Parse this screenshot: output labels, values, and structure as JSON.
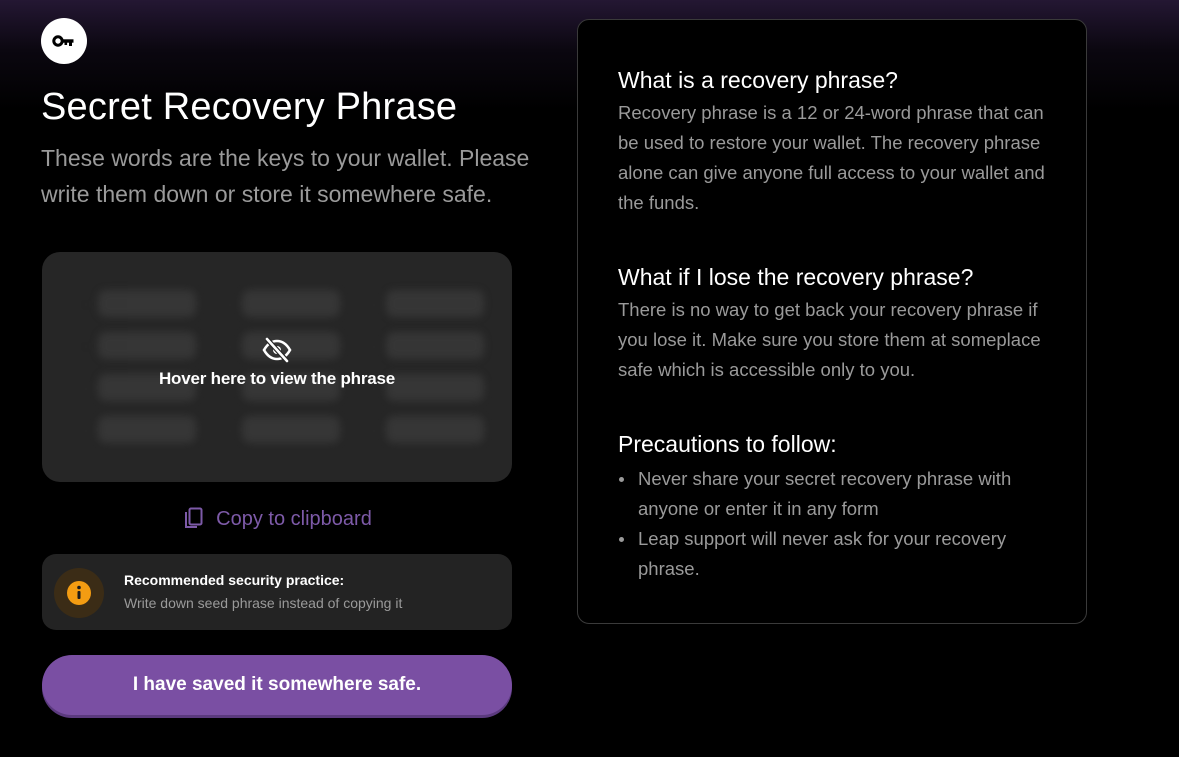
{
  "header": {
    "icon": "key-icon",
    "title": "Secret Recovery Phrase",
    "subtitle": "These words are the keys to your wallet. Please write them down or store it somewhere safe."
  },
  "phrase_box": {
    "hover_label": "Hover here to view the phrase",
    "hidden_icon": "eye-off-icon"
  },
  "copy": {
    "icon": "copy-icon",
    "label": "Copy to clipboard",
    "color": "#7d5aa8"
  },
  "alert": {
    "icon": "info-icon",
    "title": "Recommended security practice:",
    "description": "Write down seed phrase instead of copying it",
    "accent": "#f39c12"
  },
  "primary_button": {
    "label": "I have saved it somewhere safe.",
    "color": "#7a4fa3"
  },
  "info": {
    "sections": [
      {
        "heading": "What is a recovery phrase?",
        "body": "Recovery phrase is a 12 or 24-word phrase that can be used to restore your wallet. The recovery phrase alone can give anyone full access to your wallet and the funds."
      },
      {
        "heading": "What if I lose the recovery phrase?",
        "body": "There is no way to get back your recovery phrase if you lose it. Make sure you store them at someplace safe which is accessible only to you."
      },
      {
        "heading": "Precautions to follow:",
        "bullets": [
          "Never share your secret recovery phrase with anyone or enter it in any form",
          "Leap support will never ask for your recovery phrase."
        ]
      }
    ]
  }
}
